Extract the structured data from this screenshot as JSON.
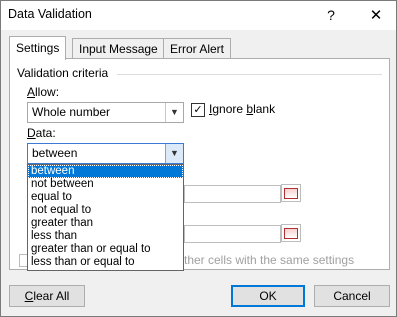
{
  "window": {
    "title": "Data Validation",
    "help_glyph": "?",
    "close_glyph": "✕"
  },
  "tabs": [
    {
      "label": "Settings",
      "active": true
    },
    {
      "label": "Input Message",
      "active": false
    },
    {
      "label": "Error Alert",
      "active": false
    }
  ],
  "criteria": {
    "group_label": "Validation criteria",
    "allow_label_first": "A",
    "allow_label_rest": "llow:",
    "allow_value": "Whole number",
    "ignore_blank_first": "I",
    "ignore_blank_mid": "gnore ",
    "ignore_blank_u": "b",
    "ignore_blank_rest": "lank",
    "ignore_blank_checked": "✓",
    "data_label_first": "D",
    "data_label_rest": "ata:",
    "data_value": "between"
  },
  "dropdown_options": [
    "between",
    "not between",
    "equal to",
    "not equal to",
    "greater than",
    "less than",
    "greater than or equal to",
    "less than or equal to"
  ],
  "apply_text": "ther cells with the same settings",
  "buttons": {
    "clear_first": "C",
    "clear_rest": "lear All",
    "ok": "OK",
    "cancel": "Cancel"
  },
  "colors": {
    "accent": "#0078d7",
    "selection": "#0078d7"
  }
}
